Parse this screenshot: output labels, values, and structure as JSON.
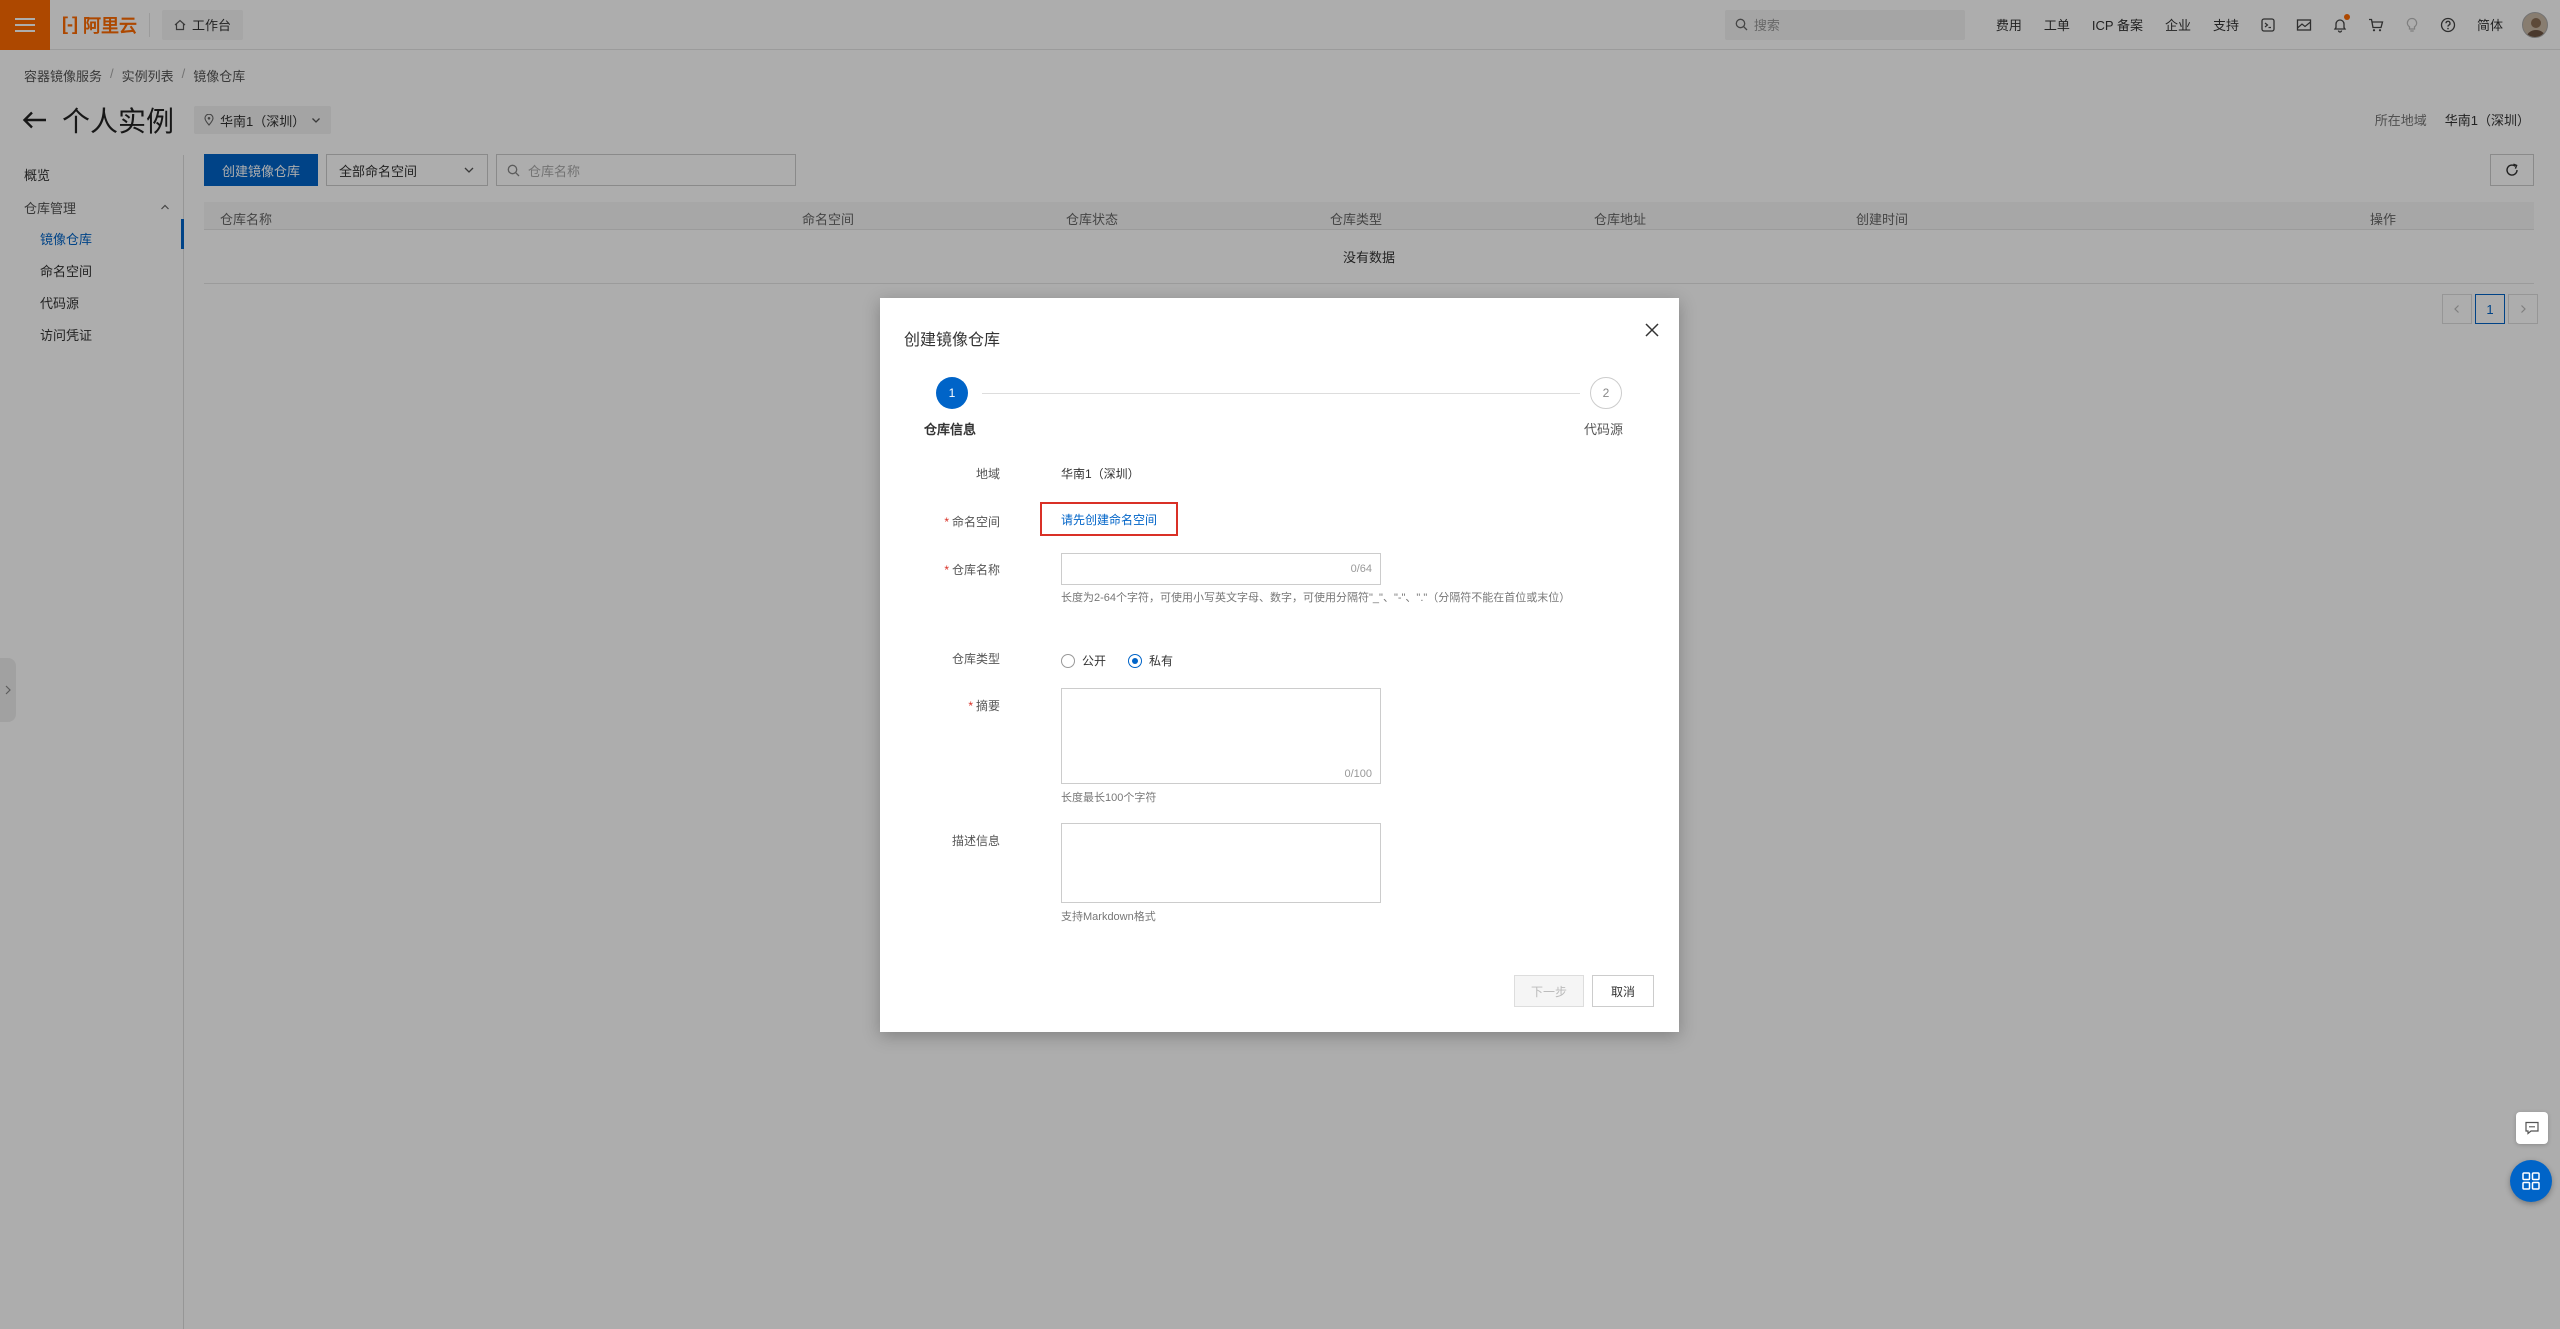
{
  "topbar": {
    "logo_text": "阿里云",
    "workbench": "工作台",
    "search_placeholder": "搜索",
    "links": [
      "费用",
      "工单",
      "ICP 备案",
      "企业",
      "支持"
    ],
    "language": "简体"
  },
  "breadcrumb": [
    "容器镜像服务",
    "实例列表",
    "镜像仓库"
  ],
  "page": {
    "title": "个人实例",
    "region_select": "华南1（深圳）",
    "region_label": "所在地域",
    "region_value": "华南1（深圳）"
  },
  "sidebar": {
    "items": [
      "概览",
      "仓库管理",
      "镜像仓库",
      "命名空间",
      "代码源",
      "访问凭证"
    ]
  },
  "toolbar": {
    "create_button": "创建镜像仓库",
    "namespace_filter": "全部命名空间",
    "search_placeholder": "仓库名称"
  },
  "table": {
    "columns": [
      "仓库名称",
      "命名空间",
      "仓库状态",
      "仓库类型",
      "仓库地址",
      "创建时间",
      "操作"
    ],
    "empty_text": "没有数据"
  },
  "pagination": {
    "current_page": "1"
  },
  "dialog": {
    "title": "创建镜像仓库",
    "steps": [
      {
        "number": "1",
        "label": "仓库信息"
      },
      {
        "number": "2",
        "label": "代码源"
      }
    ],
    "fields": {
      "region": {
        "label": "地域",
        "value": "华南1（深圳）"
      },
      "namespace": {
        "label": "命名空间",
        "link": "请先创建命名空间"
      },
      "repo_name": {
        "label": "仓库名称",
        "counter": "0/64",
        "help": "长度为2-64个字符，可使用小写英文字母、数字，可使用分隔符\"_\"、\"-\"、\".\"（分隔符不能在首位或末位）"
      },
      "repo_type": {
        "label": "仓库类型",
        "options": [
          "公开",
          "私有"
        ],
        "selected": "私有"
      },
      "summary": {
        "label": "摘要",
        "counter": "0/100",
        "help": "长度最长100个字符"
      },
      "description": {
        "label": "描述信息",
        "help": "支持Markdown格式"
      }
    },
    "next_button": "下一步",
    "cancel_button": "取消"
  },
  "colors": {
    "brand_orange": "#ff6a00",
    "primary_blue": "#0064c8",
    "highlight_red": "#d93026"
  }
}
